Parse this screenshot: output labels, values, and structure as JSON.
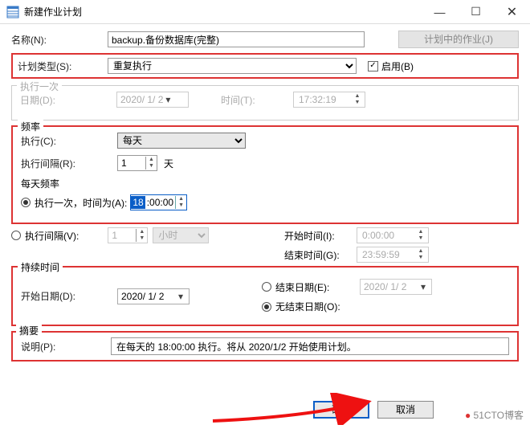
{
  "window": {
    "title": "新建作业计划",
    "min": "—",
    "max": "☐",
    "close": "✕"
  },
  "name_row": {
    "label": "名称(N):",
    "value": "backup.备份数据库(完整)",
    "btn_plan": "计划中的作业(J)"
  },
  "plan_type": {
    "label": "计划类型(S):",
    "value": "重复执行",
    "enable_label": "启用(B)"
  },
  "once": {
    "legend": "执行一次",
    "date_label": "日期(D):",
    "date_value": "2020/ 1/ 2",
    "time_label": "时间(T):",
    "time_value": "17:32:19"
  },
  "freq": {
    "legend": "频率",
    "exec_label": "执行(C):",
    "exec_value": "每天",
    "interval_label": "执行间隔(R):",
    "interval_value": "1",
    "interval_unit": "天",
    "daily_header": "每天频率",
    "once_at_label": "执行一次，时间为(A):",
    "once_at_hour": "18",
    "once_at_rest": ":00:00",
    "interval_radio_label": "执行间隔(V):",
    "interval_num": "1",
    "interval_unit_combo": "小时",
    "start_time_label": "开始时间(I):",
    "start_time_value": "0:00:00",
    "end_time_label": "结束时间(G):",
    "end_time_value": "23:59:59"
  },
  "duration": {
    "legend": "持续时间",
    "start_date_label": "开始日期(D):",
    "start_date_value": "2020/ 1/ 2",
    "end_date_label": "结束日期(E):",
    "end_date_value": "2020/ 1/ 2",
    "no_end_label": "无结束日期(O):"
  },
  "summary": {
    "legend": "摘要",
    "desc_label": "说明(P):",
    "desc_value": "在每天的 18:00:00 执行。将从 2020/1/2 开始使用计划。"
  },
  "buttons": {
    "ok": "确定",
    "cancel": "取消"
  },
  "watermark": "51CTO博客"
}
